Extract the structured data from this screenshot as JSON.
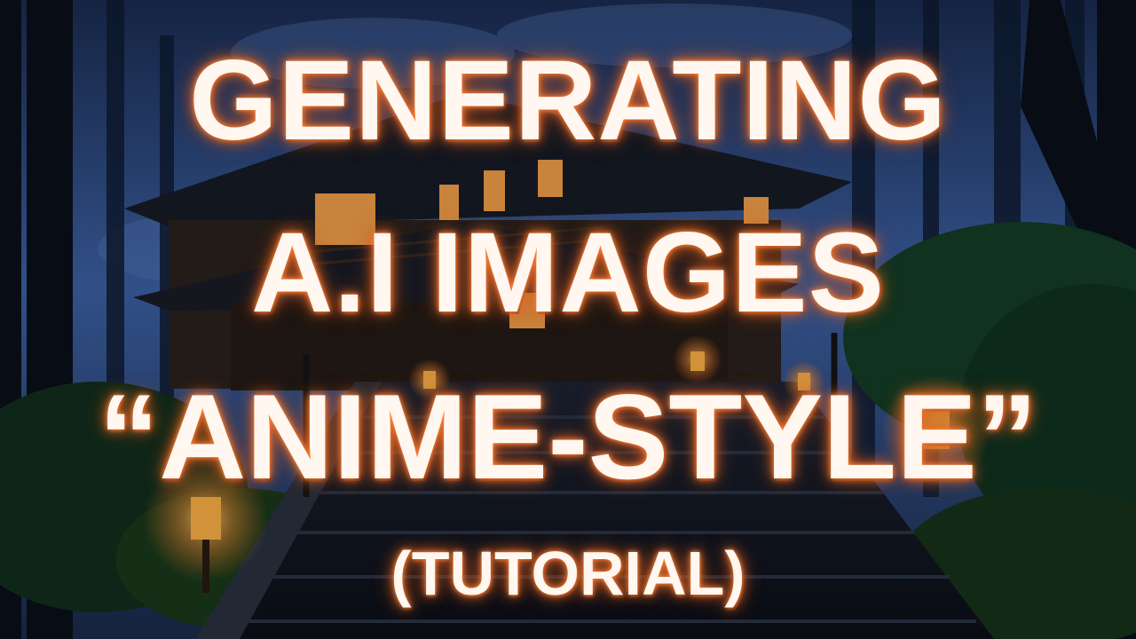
{
  "thumbnail": {
    "title_lines": [
      "GENERATING",
      "A.I IMAGES",
      "“ANIME-STYLE”",
      "(TUTORIAL)"
    ]
  },
  "palette": {
    "sky_top": "#1b2c52",
    "sky_mid": "#3d62a6",
    "foliage": "#123a24",
    "lantern_glow": "#ffb347",
    "window_glow": "#f5a04a",
    "text": "#fff7f0",
    "text_glow": "#ff8a3d"
  }
}
